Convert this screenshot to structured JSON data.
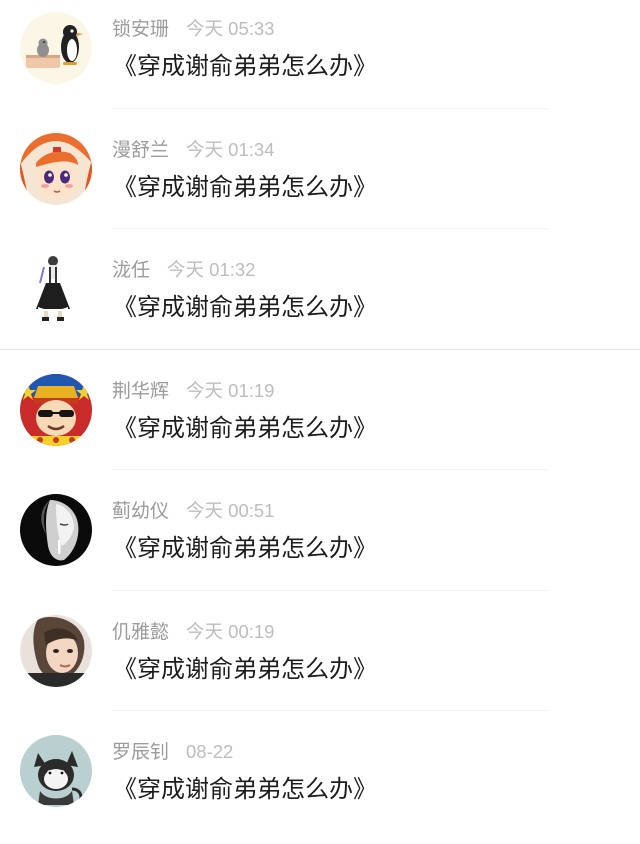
{
  "comments": [
    {
      "name": "锁安珊",
      "time": "今天 05:33",
      "title": "《穿成谢俞弟弟怎么办》",
      "avatar": "penguin-avatar-icon"
    },
    {
      "name": "漫舒兰",
      "time": "今天 01:34",
      "title": "《穿成谢俞弟弟怎么办》",
      "avatar": "anime-girl-avatar-icon"
    },
    {
      "name": "泷任",
      "time": "今天 01:32",
      "title": "《穿成谢俞弟弟怎么办》",
      "avatar": "maid-figure-avatar-icon"
    },
    {
      "name": "荆华辉",
      "time": "今天 01:19",
      "title": "《穿成谢俞弟弟怎么办》",
      "avatar": "emperor-cartoon-avatar-icon"
    },
    {
      "name": "蓟幼仪",
      "time": "今天 00:51",
      "title": "《穿成谢俞弟弟怎么办》",
      "avatar": "bw-portrait-avatar-icon"
    },
    {
      "name": "仉雅懿",
      "time": "今天 00:19",
      "title": "《穿成谢俞弟弟怎么办》",
      "avatar": "photo-portrait-avatar-icon"
    },
    {
      "name": "罗辰钊",
      "time": "08-22",
      "title": "《穿成谢俞弟弟怎么办》",
      "avatar": "cat-sketch-avatar-icon"
    }
  ]
}
